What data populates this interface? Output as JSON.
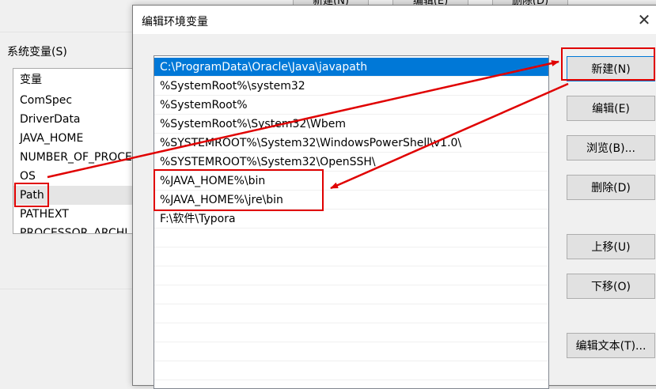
{
  "background_window": {
    "top_buttons": [
      "新建(N)",
      "编辑(E)",
      "删除(D)"
    ],
    "system_vars_label": "系统变量(S)",
    "system_vars": [
      "变量",
      "ComSpec",
      "DriverData",
      "JAVA_HOME",
      "NUMBER_OF_PROCE",
      "OS",
      "Path",
      "PATHEXT",
      "PROCESSOR_ARCHI"
    ],
    "selected_var": "Path"
  },
  "dialog": {
    "title": "编辑环境变量",
    "close_glyph": "✕",
    "paths": [
      "C:\\ProgramData\\Oracle\\Java\\javapath",
      "%SystemRoot%\\system32",
      "%SystemRoot%",
      "%SystemRoot%\\System32\\Wbem",
      "%SYSTEMROOT%\\System32\\WindowsPowerShell\\v1.0\\",
      "%SYSTEMROOT%\\System32\\OpenSSH\\",
      "%JAVA_HOME%\\bin",
      "%JAVA_HOME%\\jre\\bin",
      "F:\\软件\\Typora"
    ],
    "selected_index": 0,
    "buttons": {
      "new": "新建(N)",
      "edit": "编辑(E)",
      "browse": "浏览(B)...",
      "delete": "删除(D)",
      "move_up": "上移(U)",
      "move_down": "下移(O)",
      "edit_text": "编辑文本(T)..."
    }
  },
  "annotation": {
    "color": "#e00000",
    "selection_color": "#0078d7"
  }
}
